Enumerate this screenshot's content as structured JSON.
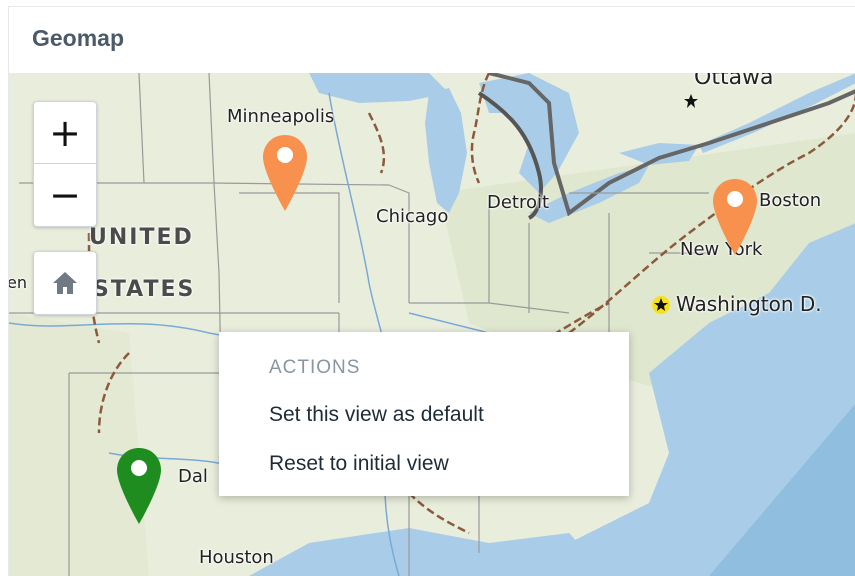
{
  "widget": {
    "title": "Geomap"
  },
  "map": {
    "zoom": {
      "in_label": "+",
      "out_label": "−"
    },
    "home_icon": "home-icon",
    "labels": {
      "ottawa": "Ottawa",
      "minneapolis": "Minneapolis",
      "chicago": "Chicago",
      "detroit": "Detroit",
      "boston": "Boston",
      "new_york": "New York",
      "washington": "Washington D.",
      "united": "UNITED",
      "states": "STATES",
      "dallas": "Dal",
      "houston": "Houston",
      "edge": "en"
    },
    "markers": [
      {
        "name": "marker-minneapolis",
        "color": "#f7914d"
      },
      {
        "name": "marker-new-york",
        "color": "#f7914d"
      },
      {
        "name": "marker-dallas",
        "color": "#1f8c1f"
      }
    ]
  },
  "context_menu": {
    "header": "ACTIONS",
    "items": [
      "Set this view as default",
      "Reset to initial view"
    ]
  },
  "colors": {
    "water": "#a9cde8",
    "land": "#e9eddc",
    "marker_orange": "#f7914d",
    "marker_green": "#1f8c1f"
  }
}
